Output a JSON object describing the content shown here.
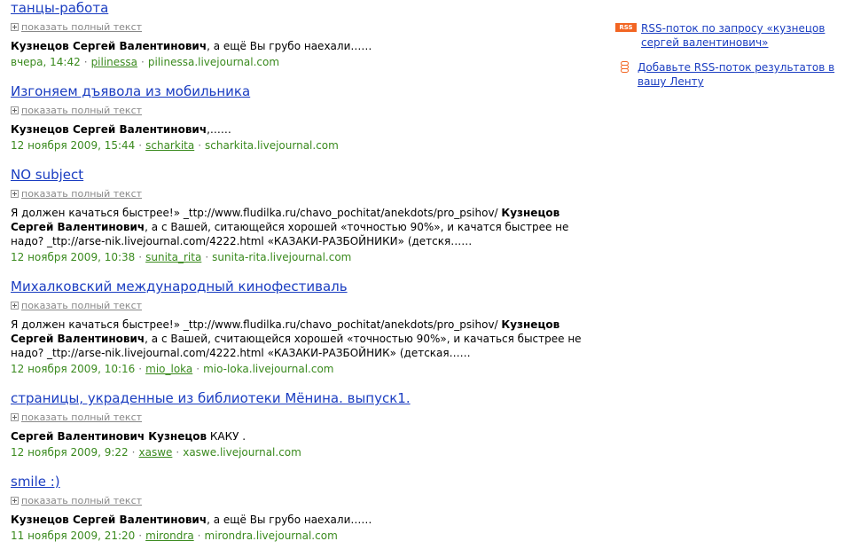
{
  "results": [
    {
      "title": "танцы-работа",
      "toggle": "показать полный текст",
      "snippet": [
        {
          "bold": true,
          "text": "Кузнецов Сергей Валентинович"
        },
        {
          "bold": false,
          "text": ", а ещё Вы грубо наехали……"
        }
      ],
      "date": "вчера, 14:42",
      "user": "pilinessa",
      "host": "pilinessa.livejournal.com"
    },
    {
      "title": "Изгоняем дъявола из мобильника",
      "toggle": "показать полный текст",
      "snippet": [
        {
          "bold": true,
          "text": "Кузнецов Сергей Валентинович"
        },
        {
          "bold": false,
          "text": ",……"
        }
      ],
      "date": "12 ноября 2009, 15:44",
      "user": "scharkita",
      "host": "scharkita.livejournal.com"
    },
    {
      "title": "NO subject",
      "toggle": "показать полный текст",
      "snippet": [
        {
          "bold": false,
          "text": "Я должен качаться быстрее!» _ttp://www.fludilka.ru/chavo_pochitat/anekdots/pro_psihov/ "
        },
        {
          "bold": true,
          "text": "Кузнецов Сергей Валентинович"
        },
        {
          "bold": false,
          "text": ", а с Вашей, ситающейся хорошей «точностью 90%», и качатся быстрее не надо? _ttp://arse-nik.livejournal.com/4222.html «КАЗАКИ-РАЗБОЙНИКИ» (детскя……"
        }
      ],
      "date": "12 ноября 2009, 10:38",
      "user": "sunita_rita",
      "host": "sunita-rita.livejournal.com"
    },
    {
      "title": "Михалковский международный кинофестиваль",
      "toggle": "показать полный текст",
      "snippet": [
        {
          "bold": false,
          "text": "Я должен качаться быстрее!» _ttp://www.fludilka.ru/chavo_pochitat/anekdots/pro_psihov/ "
        },
        {
          "bold": true,
          "text": "Кузнецов Сергей Валентинович"
        },
        {
          "bold": false,
          "text": ", а с Вашей, считающейся хорошей «точностью 90%», и качаться быстрее не надо? _ttp://arse-nik.livejournal.com/4222.html «КАЗАКИ-РАЗБОЙНИК» (детская……"
        }
      ],
      "date": "12 ноября 2009, 10:16",
      "user": "mio_loka",
      "host": "mio-loka.livejournal.com"
    },
    {
      "title": "страницы, украденные из библиотеки Мёнина. выпуск1.",
      "toggle": "показать полный текст",
      "snippet": [
        {
          "bold": true,
          "text": "Сергей Валентинович Кузнецов"
        },
        {
          "bold": false,
          "text": " КАКУ ."
        }
      ],
      "date": "12 ноября 2009, 9:22",
      "user": "xaswe",
      "host": "xaswe.livejournal.com"
    },
    {
      "title": "smile :)",
      "toggle": "показать полный текст",
      "snippet": [
        {
          "bold": true,
          "text": "Кузнецов Сергей Валентинович"
        },
        {
          "bold": false,
          "text": ", а ещё Вы грубо наехали……"
        }
      ],
      "date": "11 ноября 2009, 21:20",
      "user": "mirondra",
      "host": "mirondra.livejournal.com"
    }
  ],
  "sidebar": {
    "rss_badge": "RSS",
    "rss_feed_link": "RSS-поток по запросу «кузнецов сергей валентинович»",
    "add_feed_link": "Добавьте RSS-поток результатов в вашу Ленту"
  },
  "colors": {
    "link": "#1a3dc1",
    "meta_green": "#3a8a1e",
    "rss_orange": "#f26522"
  }
}
